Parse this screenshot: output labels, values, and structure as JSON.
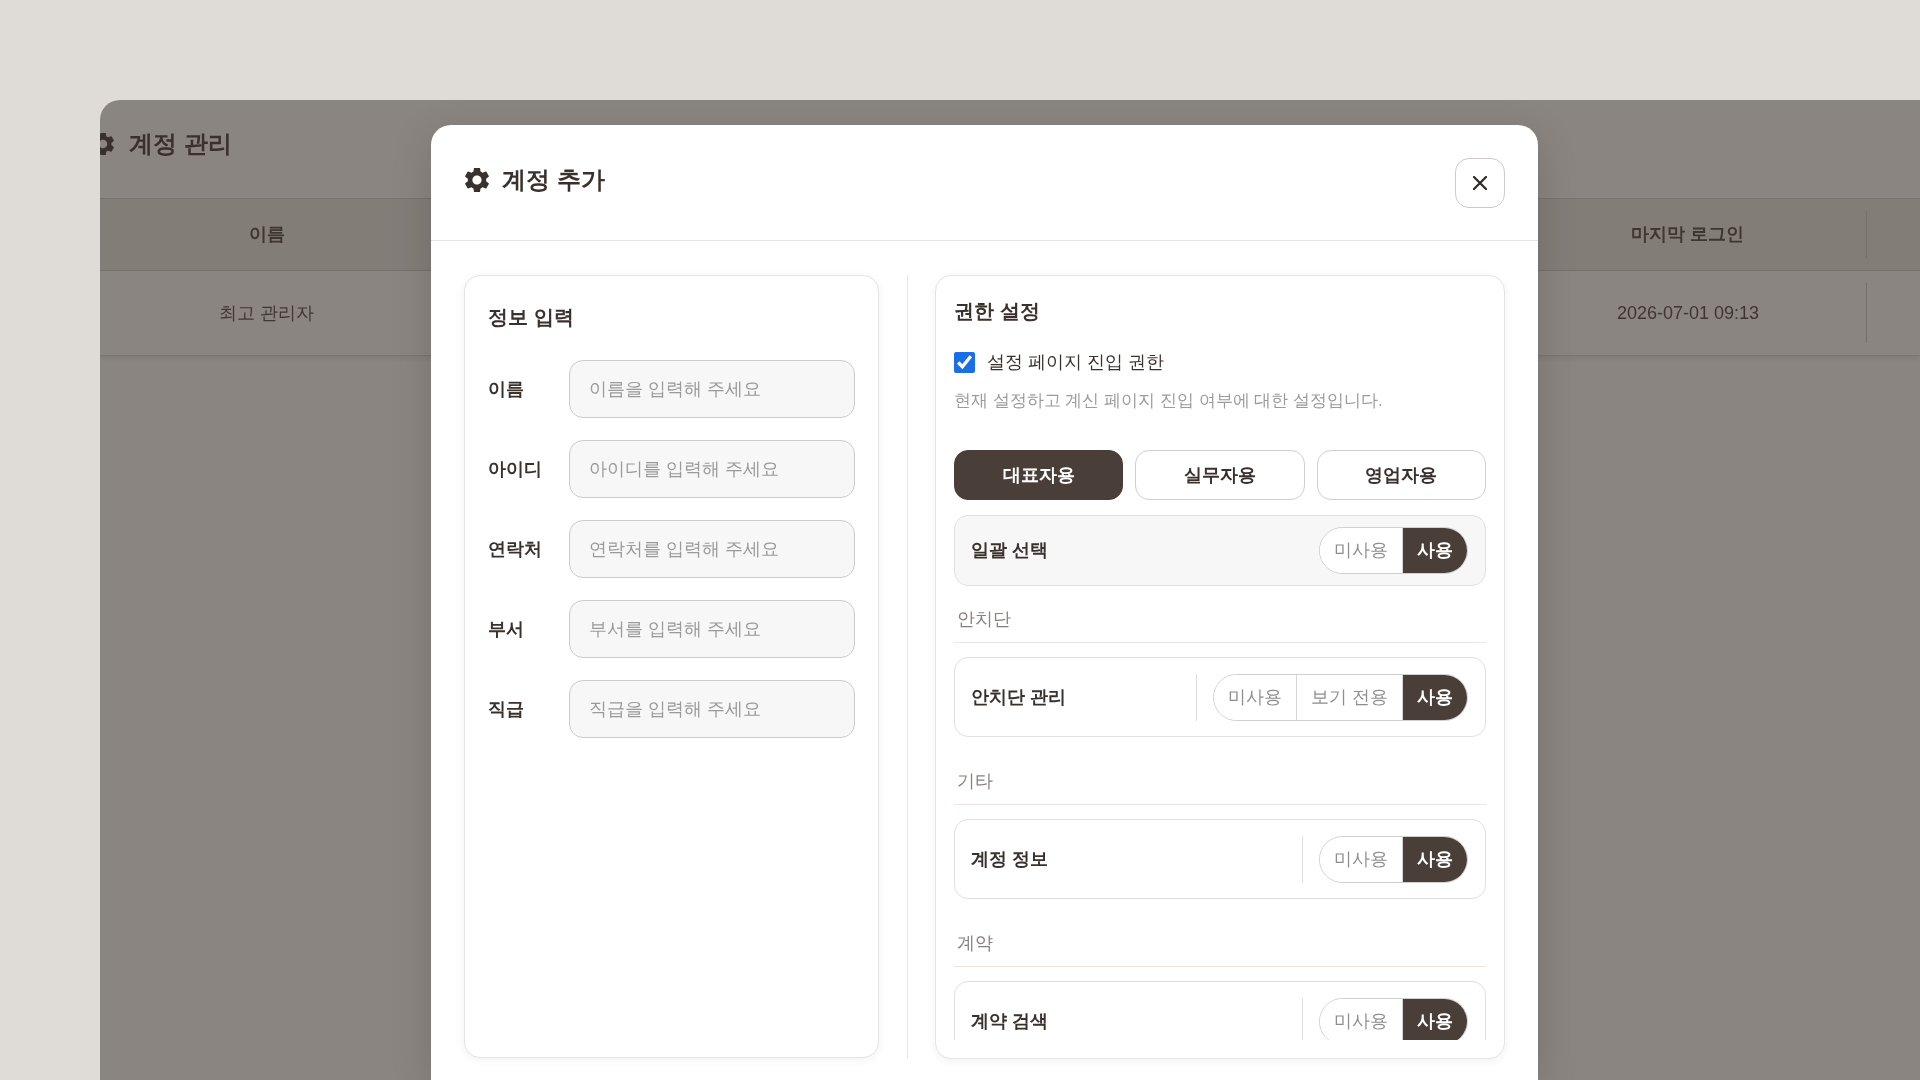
{
  "background_page": {
    "title": "계정 관리",
    "table": {
      "columns": [
        "이름",
        "마지막 로그인"
      ],
      "rows": [
        {
          "cells": [
            "최고 관리자",
            "2026-07-01 09:13"
          ]
        }
      ]
    }
  },
  "modal": {
    "title": "계정 추가",
    "info_panel": {
      "title": "정보 입력",
      "fields": [
        {
          "label": "이름",
          "placeholder": "이름을 입력해 주세요"
        },
        {
          "label": "아이디",
          "placeholder": "아이디를 입력해 주세요"
        },
        {
          "label": "연락처",
          "placeholder": "연락처를 입력해 주세요"
        },
        {
          "label": "부서",
          "placeholder": "부서를 입력해 주세요"
        },
        {
          "label": "직급",
          "placeholder": "직급을 입력해 주세요"
        }
      ]
    },
    "permission_panel": {
      "title": "권한 설정",
      "entry_permission": {
        "label": "설정 페이지 진입 권한",
        "checked": true
      },
      "description": "현재 설정하고 계신 페이지 진입 여부에 대한 설정입니다.",
      "presets": [
        {
          "label": "대표자용",
          "selected": true
        },
        {
          "label": "실무자용",
          "selected": false
        },
        {
          "label": "영업자용",
          "selected": false
        }
      ],
      "bulk_select": {
        "label": "일괄 선택",
        "options": [
          {
            "label": "미사용",
            "selected": false
          },
          {
            "label": "사용",
            "selected": true
          }
        ]
      },
      "sections": [
        {
          "title": "안치단",
          "items": [
            {
              "label": "안치단 관리",
              "options": [
                {
                  "label": "미사용",
                  "selected": false
                },
                {
                  "label": "보기 전용",
                  "selected": false
                },
                {
                  "label": "사용",
                  "selected": true
                }
              ]
            }
          ]
        },
        {
          "title": "기타",
          "items": [
            {
              "label": "계정 정보",
              "options": [
                {
                  "label": "미사용",
                  "selected": false
                },
                {
                  "label": "사용",
                  "selected": true
                }
              ]
            }
          ]
        },
        {
          "title": "계약",
          "items": [
            {
              "label": "계약 검색",
              "options": [
                {
                  "label": "미사용",
                  "selected": false
                },
                {
                  "label": "사용",
                  "selected": true
                }
              ]
            }
          ]
        }
      ]
    }
  }
}
